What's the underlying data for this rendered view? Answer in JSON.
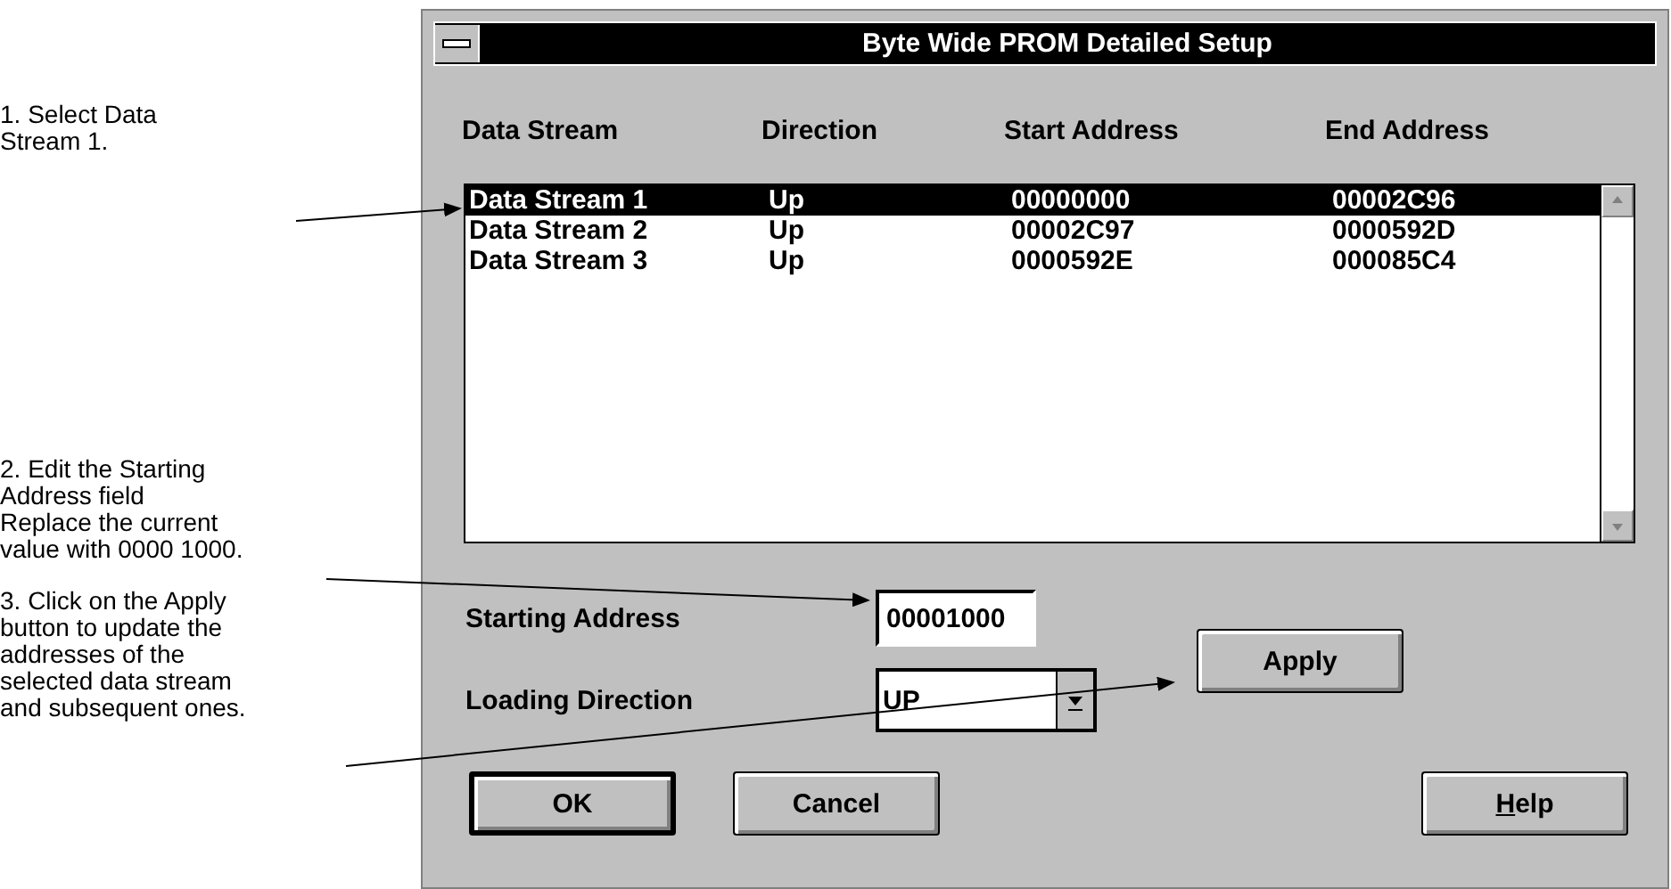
{
  "callouts": [
    {
      "lines": [
        "1. Select Data",
        "Stream 1."
      ]
    },
    {
      "lines": [
        "2. Edit the Starting",
        "Address field",
        "Replace the current",
        "value with 0000 1000."
      ]
    },
    {
      "lines": [
        "3. Click on the Apply",
        "button to update the",
        "addresses of the",
        "selected data stream",
        "and subsequent ones."
      ]
    }
  ],
  "window": {
    "title": "Byte Wide PROM Detailed Setup"
  },
  "table": {
    "columns": [
      "Data Stream",
      "Direction",
      "Start Address",
      "End Address"
    ],
    "rows": [
      {
        "cells": [
          "Data Stream 1",
          "Up",
          "00000000",
          "00002C96"
        ],
        "selected": true
      },
      {
        "cells": [
          "Data Stream 2",
          "Up",
          "00002C97",
          "0000592D"
        ],
        "selected": false
      },
      {
        "cells": [
          "Data Stream 3",
          "Up",
          "0000592E",
          "000085C4"
        ],
        "selected": false
      }
    ]
  },
  "starting_address": {
    "label": "Starting Address",
    "value": "00001000"
  },
  "loading_direction": {
    "label": "Loading Direction",
    "value": "UP"
  },
  "apply_button": "Apply",
  "buttons": [
    {
      "label": "OK",
      "default": true
    },
    {
      "label": "Cancel",
      "default": false
    },
    {
      "label_parts": [
        {
          "text": "H",
          "underlined": true
        },
        {
          "text": "elp",
          "underlined": false
        }
      ],
      "default": false
    }
  ]
}
